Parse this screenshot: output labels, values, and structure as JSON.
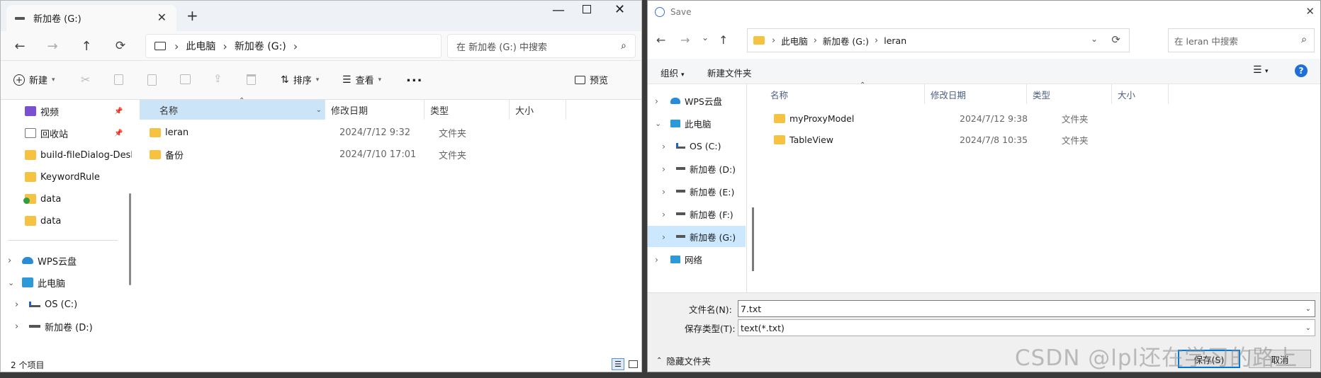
{
  "explorer": {
    "tab_title": "新加卷 (G:)",
    "new_tab": "+",
    "address": {
      "computer": "此电脑",
      "drive": "新加卷 (G:)"
    },
    "search_placeholder": "在 新加卷 (G:) 中搜索",
    "toolbar": {
      "new": "新建",
      "sort": "排序",
      "view": "查看",
      "more": "...",
      "preview": "预览"
    },
    "sidebar": [
      {
        "label": "视频",
        "icon": "video-icon",
        "pinned": true
      },
      {
        "label": "回收站",
        "icon": "recycle-bin-icon",
        "pinned": true
      },
      {
        "label": "build-fileDialog-Desk",
        "icon": "folder-icon"
      },
      {
        "label": "KeywordRule",
        "icon": "folder-icon"
      },
      {
        "label": "data",
        "icon": "folder-synced-icon"
      },
      {
        "label": "data",
        "icon": "folder-icon"
      },
      {
        "label": "WPS云盘",
        "icon": "cloud-icon"
      },
      {
        "label": "此电脑",
        "icon": "computer-icon"
      },
      {
        "label": "OS (C:)",
        "icon": "drive-icon"
      },
      {
        "label": "新加卷 (D:)",
        "icon": "drive-icon"
      }
    ],
    "columns": {
      "name": "名称",
      "date": "修改日期",
      "type": "类型",
      "size": "大小"
    },
    "files": [
      {
        "name": "leran",
        "date": "2024/7/12 9:32",
        "type": "文件夹"
      },
      {
        "name": "备份",
        "date": "2024/7/10 17:01",
        "type": "文件夹"
      }
    ],
    "status": "2 个项目"
  },
  "dialog": {
    "title": "Save",
    "address": {
      "computer": "此电脑",
      "drive": "新加卷 (G:)",
      "folder": "leran"
    },
    "search_placeholder": "在 leran 中搜索",
    "toolbar": {
      "organize": "组织",
      "new_folder": "新建文件夹"
    },
    "tree": [
      {
        "label": "WPS云盘"
      },
      {
        "label": "此电脑"
      },
      {
        "label": "OS (C:)"
      },
      {
        "label": "新加卷 (D:)"
      },
      {
        "label": "新加卷 (E:)"
      },
      {
        "label": "新加卷 (F:)"
      },
      {
        "label": "新加卷 (G:)"
      },
      {
        "label": "网络"
      }
    ],
    "columns": {
      "name": "名称",
      "date": "修改日期",
      "type": "类型",
      "size": "大小"
    },
    "files": [
      {
        "name": "myProxyModel",
        "date": "2024/7/12 9:38",
        "type": "文件夹"
      },
      {
        "name": "TableView",
        "date": "2024/7/8 10:35",
        "type": "文件夹"
      }
    ],
    "filename_label": "文件名(N):",
    "filename_value": "7.txt",
    "filetype_label": "保存类型(T):",
    "filetype_value": "text(*.txt)",
    "hide_folders": "隐藏文件夹",
    "save_button": "保存(S)",
    "cancel_button": "取消"
  },
  "watermark": "CSDN @lpl还在学习的路上"
}
